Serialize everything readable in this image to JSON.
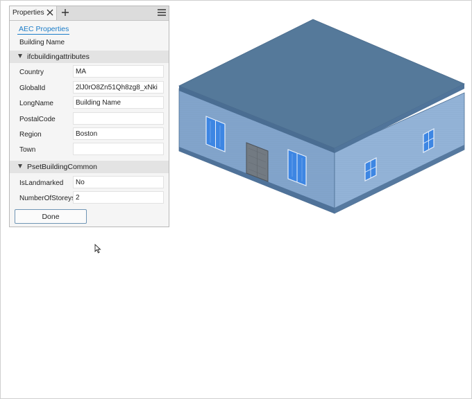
{
  "panel": {
    "tab_label": "Properties",
    "tab_icons": {
      "close": "close-icon",
      "add": "plus-icon",
      "menu": "hamburger-menu-icon"
    },
    "link": "AEC Properties",
    "subtitle": "Building Name",
    "sections": [
      {
        "title": "ifcbuildingattributes",
        "rows": [
          {
            "label": "Country",
            "value": "MA"
          },
          {
            "label": "GlobalId",
            "value": "2lJ0rO8Zn51Qh8zg8_xNki"
          },
          {
            "label": "LongName",
            "value": "Building Name"
          },
          {
            "label": "PostalCode",
            "value": ""
          },
          {
            "label": "Region",
            "value": "Boston"
          },
          {
            "label": "Town",
            "value": ""
          }
        ]
      },
      {
        "title": "PsetBuildingCommon",
        "rows": [
          {
            "label": "IsLandmarked",
            "value": "No"
          },
          {
            "label": "NumberOfStoreys",
            "value": "2"
          }
        ]
      }
    ],
    "done_label": "Done"
  },
  "colors": {
    "link": "#1a7cc8",
    "roof": "#55799a",
    "wall_left": "#7fa1c8",
    "wall_right": "#8fb0d5",
    "window": "#2f7fe0"
  }
}
